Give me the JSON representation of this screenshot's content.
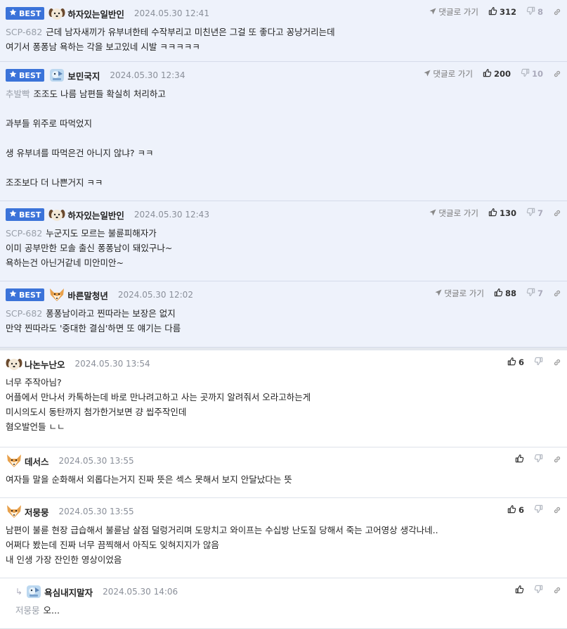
{
  "best_label": "BEST",
  "reply_link_label": "댓글로 가기",
  "best_comments": [
    {
      "avatar": "puppy",
      "nick": "하자있는일반인",
      "date": "2024.05.30 12:41",
      "up": "312",
      "down": "8",
      "lines": [
        {
          "quote": "SCP-682",
          "text": "근데 남자새끼가 유부녀한테 수작부리고 미친년은 그걸 또 좋다고 꽁냥거리는데"
        },
        {
          "quote": "",
          "text": "여기서 퐁퐁남 욕하는 각을 보고있네 시발 ㅋㅋㅋㅋㅋ"
        }
      ]
    },
    {
      "avatar": "blue-animal",
      "nick": "보민국지",
      "date": "2024.05.30 12:34",
      "up": "200",
      "down": "10",
      "lines": [
        {
          "quote": "추발빡",
          "text": "조조도 나름 남편들 확실히 처리하고"
        },
        {
          "quote": "",
          "text": ""
        },
        {
          "quote": "",
          "text": "과부들 위주로 따먹었지"
        },
        {
          "quote": "",
          "text": ""
        },
        {
          "quote": "",
          "text": "생 유부녀를 따먹은건 아니지 않냐? ㅋㅋ"
        },
        {
          "quote": "",
          "text": ""
        },
        {
          "quote": "",
          "text": "조조보다 더 나쁜거지 ㅋㅋ"
        }
      ]
    },
    {
      "avatar": "puppy",
      "nick": "하자있는일반인",
      "date": "2024.05.30 12:43",
      "up": "130",
      "down": "7",
      "lines": [
        {
          "quote": "SCP-682",
          "text": "누군지도 모르는 불륜피해자가"
        },
        {
          "quote": "",
          "text": "이미 공부만한 모솔 출신 퐁퐁남이 돼있구나~"
        },
        {
          "quote": "",
          "text": "욕하는건 아닌거같네 미안미안~"
        }
      ]
    },
    {
      "avatar": "fox",
      "nick": "바른말청년",
      "date": "2024.05.30 12:02",
      "up": "88",
      "down": "7",
      "lines": [
        {
          "quote": "SCP-682",
          "text": "퐁퐁남이라고 찐따라는 보장은 없지"
        },
        {
          "quote": "",
          "text": "만약 찐따라도 '중대한 결심'하면 또 얘기는 다름"
        }
      ]
    }
  ],
  "comments": [
    {
      "avatar": "puppy",
      "nick": "나논누난오",
      "date": "2024.05.30 13:54",
      "up": "6",
      "nested": false,
      "lines": [
        {
          "quote": "",
          "text": "너무 주작아님?"
        },
        {
          "quote": "",
          "text": "어플에서 만나서 카톡하는데 바로 만나려고하고 사는 곳까지 알려줘서 오라고하는게"
        },
        {
          "quote": "",
          "text": "미시의도시 동탄까지 첨가한거보면 걍 씹주작인데"
        },
        {
          "quote": "",
          "text": "혐오발언들 ㄴㄴ"
        }
      ]
    },
    {
      "avatar": "fox",
      "nick": "데서스",
      "date": "2024.05.30 13:55",
      "up": "",
      "nested": false,
      "lines": [
        {
          "quote": "",
          "text": "여자들 말을 순화해서 외롭다는거지 진짜 뜻은 섹스 못해서 보지 안달났다는 뜻"
        }
      ]
    },
    {
      "avatar": "fox",
      "nick": "저뭉뭉",
      "date": "2024.05.30 13:55",
      "up": "6",
      "nested": false,
      "lines": [
        {
          "quote": "",
          "text": "남편이 불륜 현장 급습해서 불륜남 살점 덜렁거리며 도망치고 와이프는 수십방 난도질 당해서 죽는 고어영상 생각나네.."
        },
        {
          "quote": "",
          "text": "어쩌다 봤는데 진짜 너무 끔찍해서 아직도 잊혀지지가 않음"
        },
        {
          "quote": "",
          "text": "내 인생 가장 잔인한 영상이었음"
        }
      ]
    },
    {
      "avatar": "blue-animal",
      "nick": "욕심내지말자",
      "date": "2024.05.30 14:06",
      "up": "",
      "nested": true,
      "lines": [
        {
          "quote": "저뭉뭉",
          "text": "오..."
        }
      ]
    }
  ],
  "colors": {
    "best_bg": "#eef2fb",
    "badge": "#3b73d9",
    "date": "#8a8f99",
    "quote": "#9aa0aa"
  }
}
